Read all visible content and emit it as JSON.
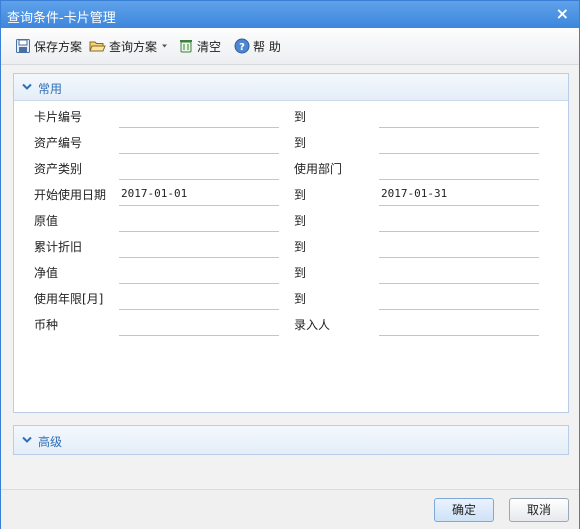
{
  "window": {
    "title": "查询条件-卡片管理",
    "close_glyph": "×"
  },
  "toolbar": {
    "save_scheme": "保存方案",
    "query_scheme": "查询方案",
    "clear": "清空",
    "help": "帮 助"
  },
  "common_panel": {
    "title": "常用",
    "rows": [
      {
        "label": "卡片编号",
        "from_value": "",
        "right_label": "到",
        "to_value": ""
      },
      {
        "label": "资产编号",
        "from_value": "",
        "right_label": "到",
        "to_value": ""
      },
      {
        "label": "资产类别",
        "from_value": "",
        "right_label": "使用部门",
        "to_value": ""
      },
      {
        "label": "开始使用日期",
        "from_value": "2017-01-01",
        "right_label": "到",
        "to_value": "2017-01-31"
      },
      {
        "label": "原值",
        "from_value": "",
        "right_label": "到",
        "to_value": ""
      },
      {
        "label": "累计折旧",
        "from_value": "",
        "right_label": "到",
        "to_value": ""
      },
      {
        "label": "净值",
        "from_value": "",
        "right_label": "到",
        "to_value": ""
      },
      {
        "label": "使用年限[月]",
        "from_value": "",
        "right_label": "到",
        "to_value": ""
      },
      {
        "label": "币种",
        "from_value": "",
        "right_label": "录入人",
        "to_value": ""
      }
    ]
  },
  "advanced_panel": {
    "title": "高级"
  },
  "footer": {
    "ok": "确定",
    "cancel": "取消"
  },
  "colors": {
    "title_bar": "#3d86dd",
    "panel_title": "#2f6fb8",
    "panel_border": "#b9cde6"
  },
  "icons": [
    "save-icon",
    "folder-open-icon",
    "dropdown-arrow-icon",
    "trash-icon",
    "help-icon",
    "chevron-down-icon",
    "chevron-right-icon",
    "close-icon"
  ]
}
